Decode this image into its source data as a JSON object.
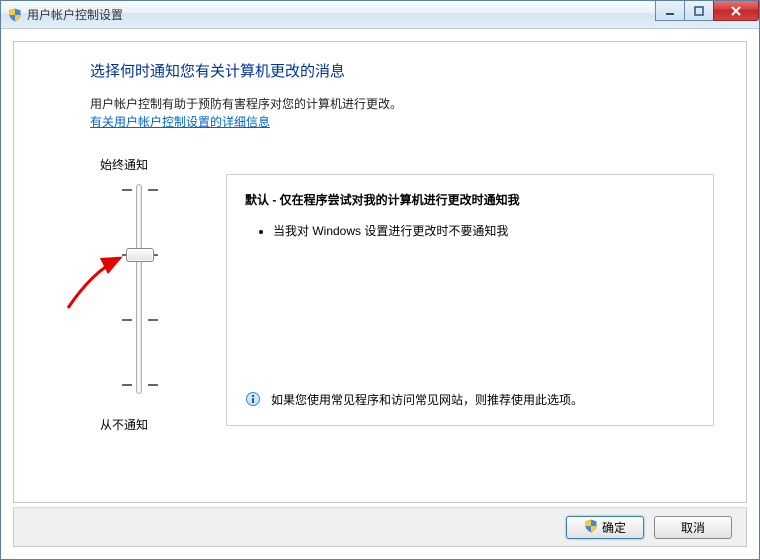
{
  "window": {
    "title": "用户帐户控制设置"
  },
  "heading": "选择何时通知您有关计算机更改的消息",
  "description": "用户帐户控制有助于预防有害程序对您的计算机进行更改。",
  "help_link": "有关用户帐户控制设置的详细信息",
  "slider": {
    "top_label": "始终通知",
    "bottom_label": "从不通知",
    "levels": 4,
    "selected_index": 1
  },
  "detail": {
    "title": "默认 - 仅在程序尝试对我的计算机进行更改时通知我",
    "bullets": [
      "当我对 Windows 设置进行更改时不要通知我"
    ],
    "recommendation": "如果您使用常见程序和访问常见网站，则推荐使用此选项。"
  },
  "buttons": {
    "ok": "确定",
    "cancel": "取消"
  },
  "icons": {
    "shield": "shield-icon",
    "info": "info-icon",
    "minimize": "minimize-icon",
    "maximize": "maximize-icon",
    "close": "close-icon"
  }
}
